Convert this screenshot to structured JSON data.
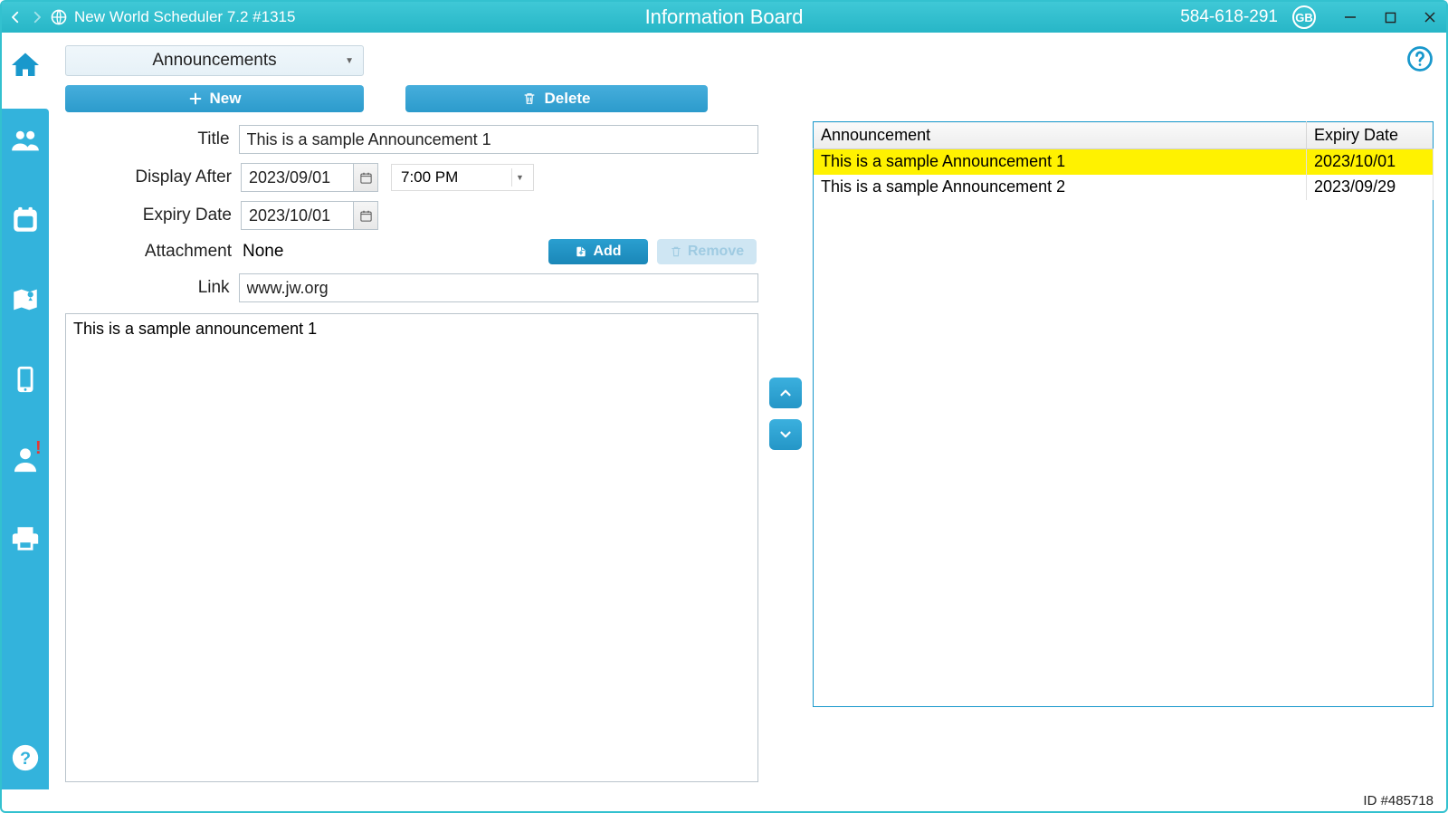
{
  "titlebar": {
    "app_name": "New World Scheduler 7.2 #1315",
    "page_title": "Information Board",
    "account_id": "584-618-291",
    "locale_badge": "GB"
  },
  "toolbar": {
    "category": "Announcements",
    "new_label": "New",
    "delete_label": "Delete"
  },
  "form": {
    "labels": {
      "title": "Title",
      "display_after": "Display After",
      "expiry": "Expiry Date",
      "attachment": "Attachment",
      "link": "Link"
    },
    "title_value": "This is a sample Announcement 1",
    "display_after_date": "2023/09/01",
    "display_after_time": "7:00 PM",
    "expiry_date": "2023/10/01",
    "attachment_value": "None",
    "add_label": "Add",
    "remove_label": "Remove",
    "link_value": "www.jw.org",
    "body_value": "This is a sample announcement 1"
  },
  "table": {
    "columns": {
      "announcement": "Announcement",
      "expiry": "Expiry Date"
    },
    "rows": [
      {
        "title": "This is a sample Announcement 1",
        "expiry": "2023/10/01",
        "selected": true
      },
      {
        "title": "This is a sample Announcement 2",
        "expiry": "2023/09/29",
        "selected": false
      }
    ]
  },
  "statusbar": {
    "id_label": "ID #485718"
  }
}
